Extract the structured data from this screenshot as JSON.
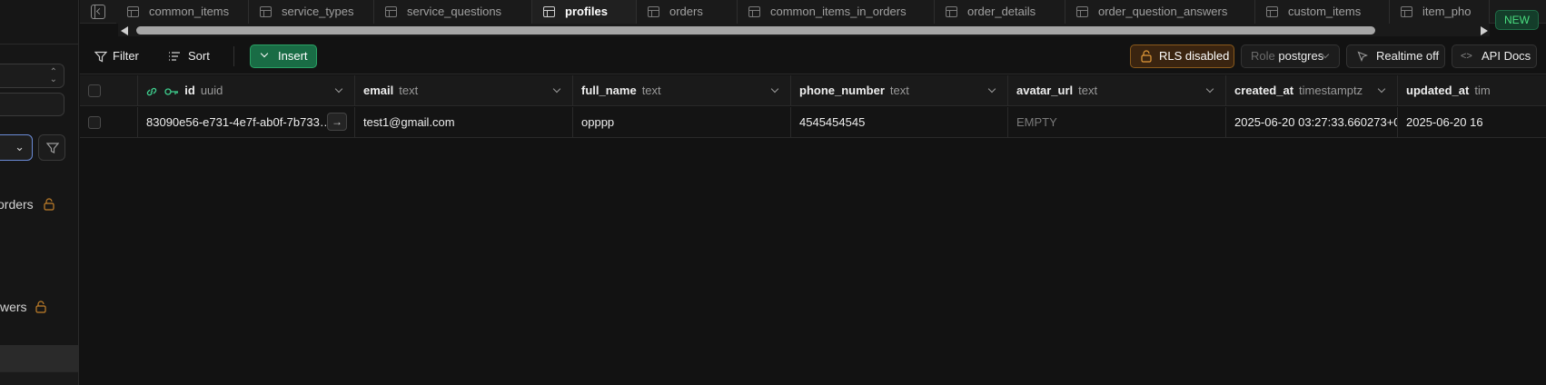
{
  "sidebar": {
    "items": [
      {
        "label": "orders"
      },
      {
        "label": "wers"
      }
    ]
  },
  "tabs": [
    {
      "label": "common_items",
      "width": 146
    },
    {
      "label": "service_types",
      "width": 138
    },
    {
      "label": "service_questions",
      "width": 174
    },
    {
      "label": "profiles",
      "width": 115
    },
    {
      "label": "orders",
      "width": 111
    },
    {
      "label": "common_items_in_orders",
      "width": 217
    },
    {
      "label": "order_details",
      "width": 144
    },
    {
      "label": "order_question_answers",
      "width": 209
    },
    {
      "label": "custom_items",
      "width": 148
    },
    {
      "label": "item_pho",
      "width": 110
    }
  ],
  "active_tab": "profiles",
  "new_badge": "NEW",
  "toolbar": {
    "filter_label": "Filter",
    "sort_label": "Sort",
    "insert_label": "Insert",
    "rls_label": "RLS disabled",
    "role_label": "Role",
    "role_value": "postgres",
    "realtime_label": "Realtime off",
    "apidocs_label": "API Docs"
  },
  "columns": [
    {
      "name": "id",
      "type": "uuid"
    },
    {
      "name": "email",
      "type": "text"
    },
    {
      "name": "full_name",
      "type": "text"
    },
    {
      "name": "phone_number",
      "type": "text"
    },
    {
      "name": "avatar_url",
      "type": "text"
    },
    {
      "name": "created_at",
      "type": "timestamptz"
    },
    {
      "name": "updated_at",
      "type": "tim"
    }
  ],
  "rows": [
    {
      "id": "83090e56-e731-4e7f-ab0f-7b733…",
      "email": "test1@gmail.com",
      "full_name": "opppp",
      "phone_number": "4545454545",
      "avatar_url": "EMPTY",
      "created_at": "2025-06-20 03:27:33.660273+0",
      "updated_at": "2025-06-20 16"
    }
  ],
  "colors": {
    "accent_green": "#196c45",
    "rls_warning": "#8a5a1c",
    "new_badge": "#4ade80"
  }
}
